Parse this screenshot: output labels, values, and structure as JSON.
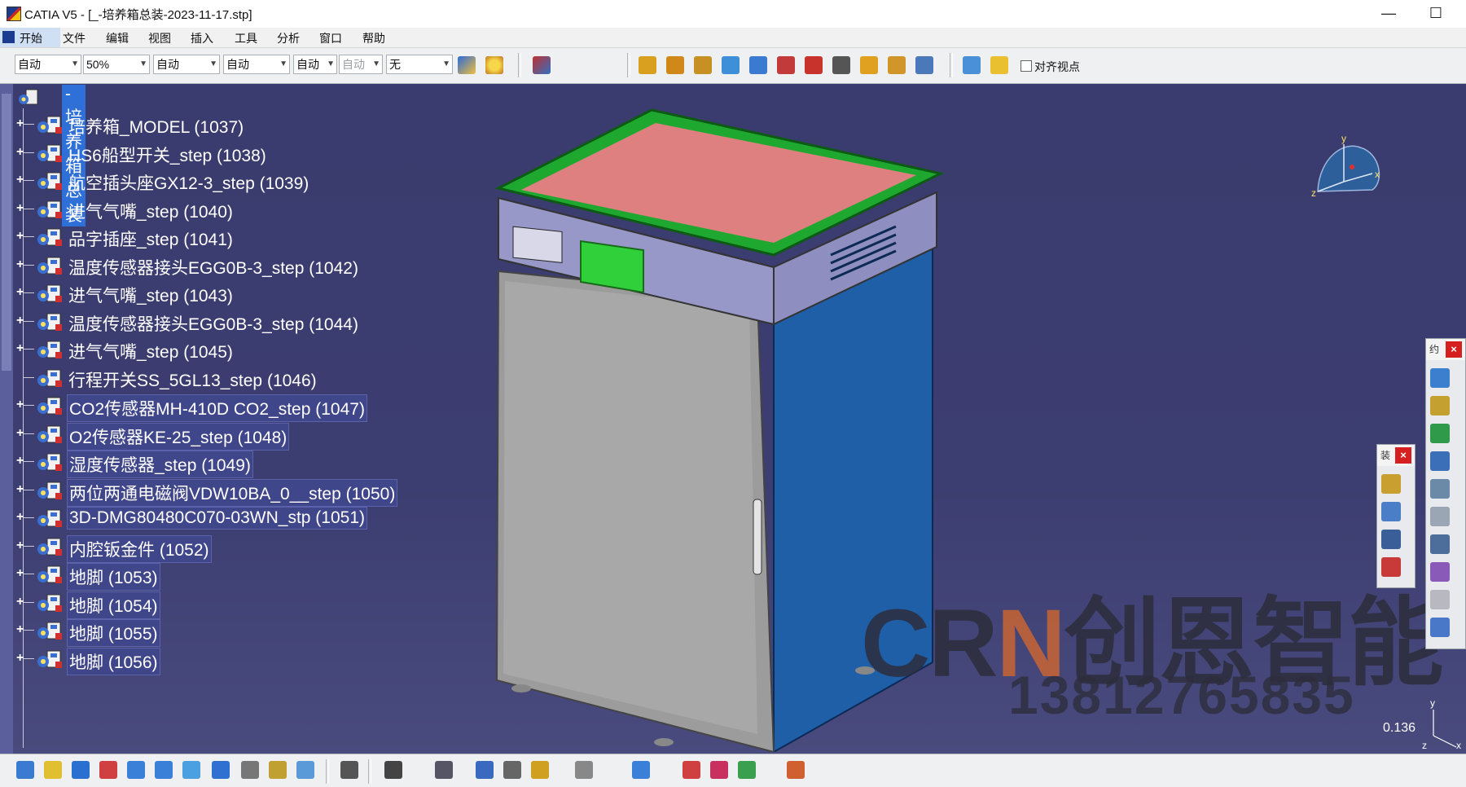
{
  "window": {
    "title": "CATIA V5 - [_-培养箱总装-2023-11-17.stp]",
    "minimize_label": "—",
    "maximize_label": "☐"
  },
  "menu": {
    "start": "开始",
    "items": [
      "文件",
      "编辑",
      "视图",
      "插入",
      "工具",
      "分析",
      "窗口",
      "帮助"
    ]
  },
  "toolbar": {
    "selects": [
      "自动",
      "50%",
      "自动",
      "自动",
      "自动",
      "自动",
      "无"
    ],
    "align_viewpoint_label": "对齐视点"
  },
  "tree": {
    "root": "-培养箱总装",
    "items": [
      {
        "label": "培养箱_MODEL (1037)",
        "expand": "+"
      },
      {
        "label": "HS6船型开关_step (1038)",
        "expand": "+"
      },
      {
        "label": "航空插头座GX12-3_step (1039)",
        "expand": "+"
      },
      {
        "label": "进气气嘴_step (1040)",
        "expand": "+"
      },
      {
        "label": "品字插座_step (1041)",
        "expand": "+"
      },
      {
        "label": "温度传感器接头EGG0B-3_step (1042)",
        "expand": "+"
      },
      {
        "label": "进气气嘴_step (1043)",
        "expand": "+"
      },
      {
        "label": "温度传感器接头EGG0B-3_step (1044)",
        "expand": "+"
      },
      {
        "label": "进气气嘴_step (1045)",
        "expand": "+"
      },
      {
        "label": "行程开关SS_5GL13_step (1046)",
        "expand": ""
      },
      {
        "label": "CO2传感器MH-410D CO2_step (1047)",
        "expand": "+"
      },
      {
        "label": "O2传感器KE-25_step (1048)",
        "expand": "+"
      },
      {
        "label": "湿度传感器_step (1049)",
        "expand": "+"
      },
      {
        "label": "两位两通电磁阀VDW10BA_0__step (1050)",
        "expand": "+"
      },
      {
        "label": "3D-DMG80480C070-03WN_stp (1051)",
        "expand": "+"
      },
      {
        "label": "内腔钣金件 (1052)",
        "expand": "+"
      },
      {
        "label": "地脚 (1053)",
        "expand": "+"
      },
      {
        "label": "地脚 (1054)",
        "expand": "+"
      },
      {
        "label": "地脚 (1055)",
        "expand": "+"
      },
      {
        "label": "地脚 (1056)",
        "expand": "+"
      }
    ]
  },
  "compass_axes": {
    "y": "y",
    "x": "x",
    "z": "z"
  },
  "corner_axes": {
    "y": "y",
    "x": "x",
    "z": "z"
  },
  "scale": "0.136",
  "watermark": {
    "brand_a": "CR",
    "brand_b": "N",
    "brand_c": "创恩智能",
    "phone": "13812765835"
  },
  "floating_panels": {
    "right_title": "约",
    "mid_title": "装",
    "close": "×"
  },
  "colors": {
    "viewport_bg": "#3b3c6f",
    "highlight": "#2f6fd8",
    "accent_orange": "#c86432"
  }
}
